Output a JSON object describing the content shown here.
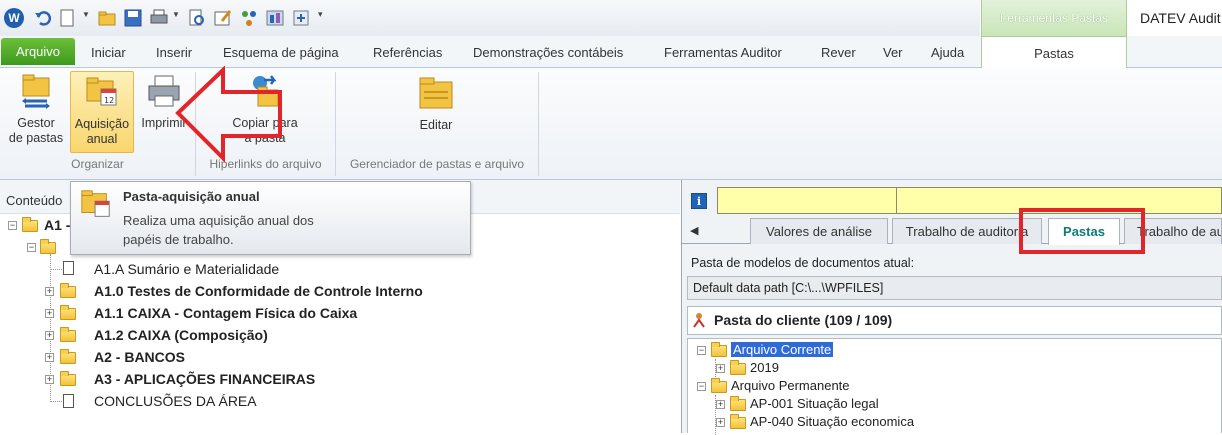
{
  "app": {
    "title": "DATEV Audit"
  },
  "qat": {
    "icons": [
      "app-logo-icon",
      "undo-icon",
      "new-document-icon",
      "open-folder-icon",
      "save-icon",
      "print-icon",
      "print-preview-icon",
      "edit-icon",
      "network-icon",
      "tools-icon",
      "settings-icon",
      "customize-icon"
    ]
  },
  "context_tab": {
    "header": "Ferramentas Pastas",
    "tab": "Pastas"
  },
  "ribbon_tabs": [
    "Arquivo",
    "Iniciar",
    "Inserir",
    "Esquema de página",
    "Referências",
    "Demonstrações contábeis",
    "Ferramentas Auditor",
    "Rever",
    "Ver",
    "Ajuda"
  ],
  "ribbon": {
    "gestor": {
      "line1": "Gestor",
      "line2": "de pastas"
    },
    "aquisicao": {
      "line1": "Aquisição",
      "line2": "anual"
    },
    "imprimir": {
      "line1": "Imprimir"
    },
    "copiar": {
      "line1": "Copiar para",
      "line2": "a pasta"
    },
    "editar": {
      "line1": "Editar"
    },
    "groups": {
      "organizar": "Organizar",
      "hiperlinks": "Hiperlinks do arquivo",
      "gerenciador": "Gerenciador de pastas e arquivo"
    }
  },
  "left_panel": {
    "header": "Conteúdo"
  },
  "tooltip": {
    "title": "Pasta-aquisição anual",
    "line1": "Realiza uma aquisição anual dos",
    "line2": "papéis de trabalho."
  },
  "tree_left": {
    "root": "A1 -",
    "items": [
      {
        "label": "A1.A Sumário e Materialidade",
        "bold": false
      },
      {
        "label": "A1.0  Testes de Conformidade de Controle Interno",
        "bold": true
      },
      {
        "label": "A1.1 CAIXA - Contagem Física do Caixa",
        "bold": true
      },
      {
        "label": "A1.2 CAIXA (Composição)",
        "bold": true
      },
      {
        "label": "A2 - BANCOS",
        "bold": true
      },
      {
        "label": "A3 - APLICAÇÕES FINANCEIRAS",
        "bold": true
      },
      {
        "label": "CONCLUSÕES DA ÁREA",
        "bold": false
      }
    ]
  },
  "right_panel": {
    "info": "i",
    "tabs": [
      "Valores de análise",
      "Trabalho de auditoria",
      "Pastas",
      "Trabalho de au"
    ],
    "label_modelos": "Pasta de modelos de documentos atual:",
    "path": "Default data path [C:\\...\\WPFILES]",
    "client": "Pasta do cliente (109 / 109)",
    "tree": {
      "corrente": "Arquivo Corrente",
      "ano": "2019",
      "permanente": "Arquivo Permanente",
      "ap001": "AP-001 Situação legal",
      "ap040": "AP-040 Situação economica"
    }
  },
  "colors": {
    "accent_green": "#3e9a1c",
    "highlight_red": "#e0262b",
    "selection_blue": "#2f6bd6",
    "field_yellow": "#ffffaa"
  }
}
